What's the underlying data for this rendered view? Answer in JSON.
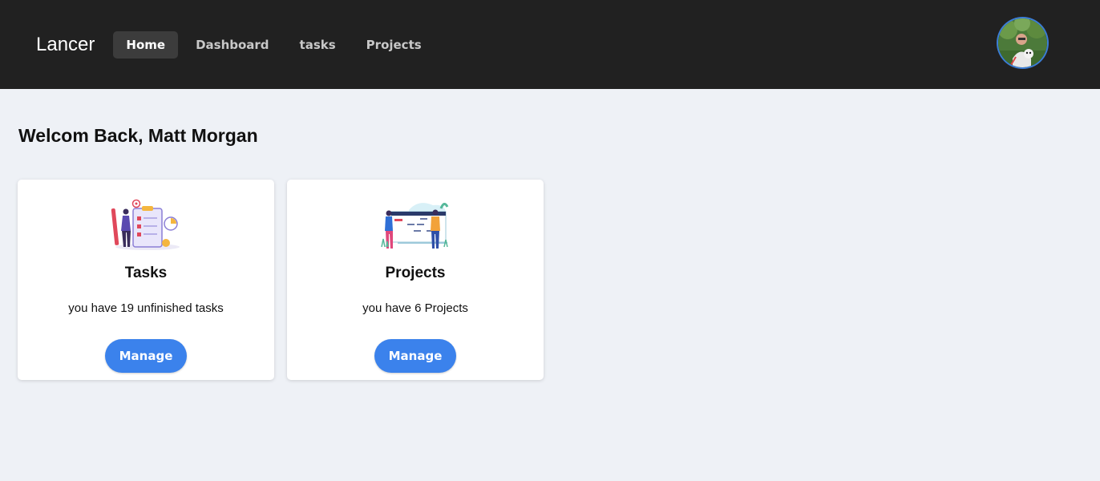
{
  "nav": {
    "brand": "Lancer",
    "items": [
      {
        "label": "Home",
        "active": true
      },
      {
        "label": "Dashboard",
        "active": false
      },
      {
        "label": "tasks",
        "active": false
      },
      {
        "label": "Projects",
        "active": false
      }
    ],
    "avatar_icon": "user-avatar-photo"
  },
  "welcome": "Welcom Back, Matt Morgan",
  "cards": [
    {
      "title": "Tasks",
      "text": "you have 19 unfinished tasks",
      "button": "Manage",
      "illustration": "tasks-checklist-illustration"
    },
    {
      "title": "Projects",
      "text": "you have 6 Projects",
      "button": "Manage",
      "illustration": "projects-board-illustration"
    }
  ],
  "colors": {
    "navbar": "#212121",
    "background": "#eef1f6",
    "accent": "#3b82ec"
  }
}
